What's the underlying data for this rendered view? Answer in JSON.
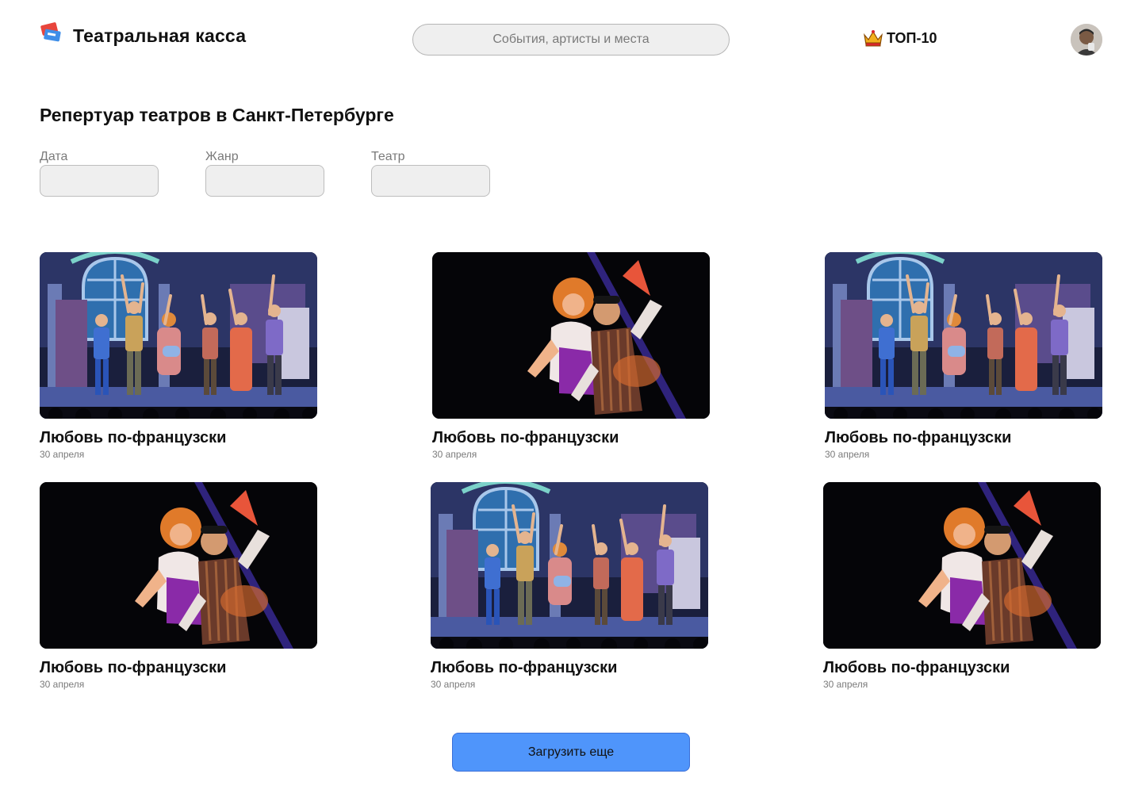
{
  "header": {
    "brand": "Театральная касса",
    "search_placeholder": "События, артисты и места",
    "top10_label": "ТОП-10"
  },
  "main": {
    "title": "Репертуар театров в Санкт-Петербурге",
    "filters": [
      {
        "label": "Дата",
        "value": ""
      },
      {
        "label": "Жанр",
        "value": ""
      },
      {
        "label": "Театр",
        "value": ""
      }
    ],
    "cards": [
      {
        "title": "Любовь по-французски",
        "date": "30 апреля",
        "image": "ensemble-stage"
      },
      {
        "title": "Любовь по-французски",
        "date": "30 апреля",
        "image": "duet-dance"
      },
      {
        "title": "Любовь по-французски",
        "date": "30 апреля",
        "image": "ensemble-stage"
      },
      {
        "title": "Любовь по-французски",
        "date": "30 апреля",
        "image": "duet-dance"
      },
      {
        "title": "Любовь по-французски",
        "date": "30 апреля",
        "image": "ensemble-stage"
      },
      {
        "title": "Любовь по-французски",
        "date": "30 апреля",
        "image": "duet-dance"
      }
    ],
    "load_more_label": "Загрузить еще"
  },
  "colors": {
    "accent": "#4f95fb",
    "input_bg": "#efefef",
    "muted_text": "#7a7a7a"
  }
}
